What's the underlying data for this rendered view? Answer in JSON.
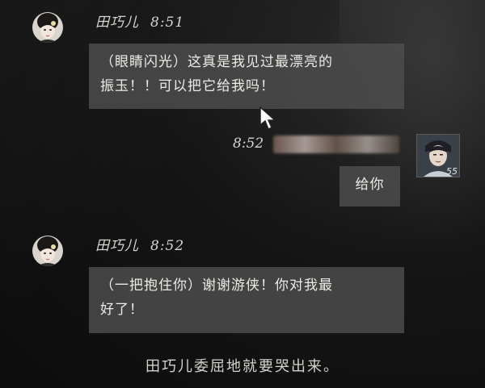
{
  "dialogue": [
    {
      "speaker": "田巧儿",
      "time": "8:51",
      "avatar_icon": "girl-portrait-icon",
      "lines": [
        "（眼睛闪光）这真是我见过最漂亮的",
        "振玉！！可以把它给我吗！"
      ]
    },
    {
      "speaker_level": "55",
      "time": "8:52",
      "avatar_icon": "player-portrait-icon",
      "text": "给你"
    },
    {
      "speaker": "田巧儿",
      "time": "8:52",
      "avatar_icon": "girl-portrait-icon",
      "lines": [
        "（一把抱住你）谢谢游侠！你对我最",
        "好了！"
      ]
    }
  ],
  "narration": "田巧儿委屈地就要哭出来。",
  "colors": {
    "bubble": "#4e4e4e",
    "text": "#ecebe6",
    "background": "#141414"
  }
}
